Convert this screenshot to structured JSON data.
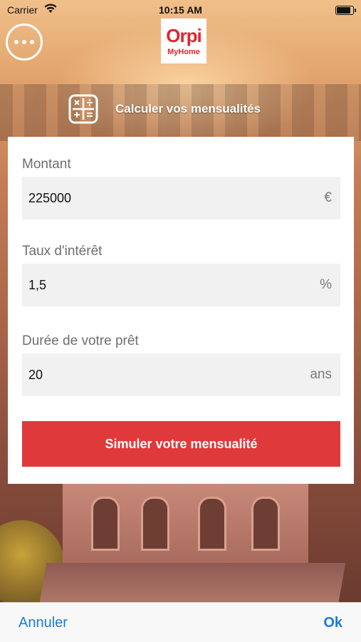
{
  "status_bar": {
    "carrier": "Carrier",
    "time": "10:15 AM"
  },
  "header": {
    "logo_brand": "Orpi",
    "logo_sub": "MyHome",
    "title": "Calculer vos mensualités"
  },
  "form": {
    "amount": {
      "label": "Montant",
      "value": "225000",
      "unit": "€"
    },
    "rate": {
      "label": "Taux d'intérêt",
      "value": "1,5",
      "unit": "%"
    },
    "duration": {
      "label": "Durée de votre prêt",
      "value": "20",
      "unit": "ans"
    },
    "submit_label": "Simuler votre mensualité"
  },
  "footer": {
    "cancel_label": "Annuler",
    "ok_label": "Ok"
  },
  "colors": {
    "accent": "#e0393b",
    "brand": "#e0262e",
    "link": "#1a7ae0"
  }
}
